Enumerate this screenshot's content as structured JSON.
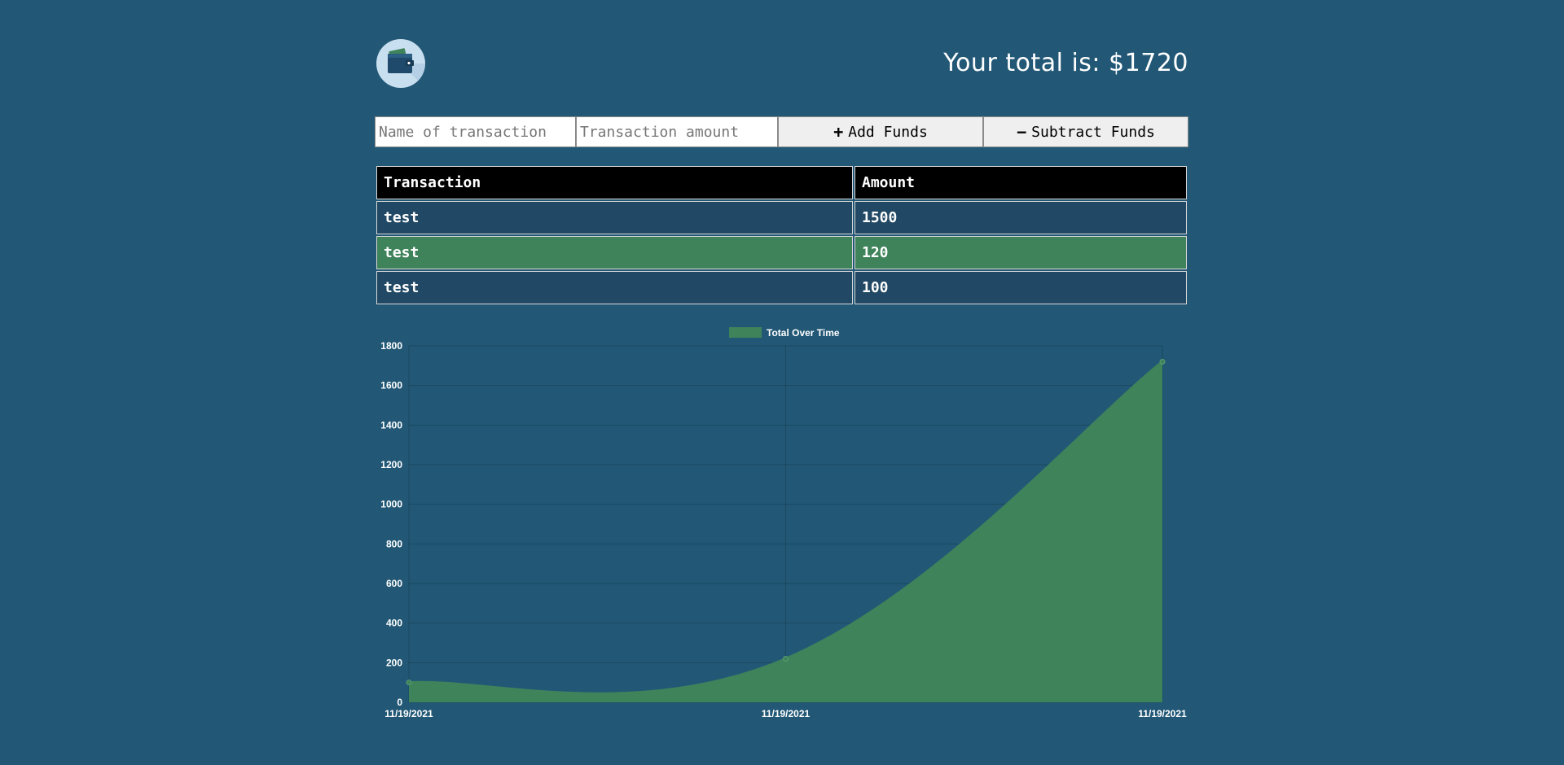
{
  "header": {
    "logo_icon": "wallet-icon",
    "total_text": "Your total is: $1720"
  },
  "form": {
    "name_placeholder": "Name of transaction",
    "amount_placeholder": "Transaction amount",
    "add_label": "Add Funds",
    "add_icon": "plus-icon",
    "subtract_label": "Subtract Funds",
    "subtract_icon": "minus-icon"
  },
  "table": {
    "headers": [
      "Transaction",
      "Amount"
    ],
    "rows": [
      {
        "name": "test",
        "amount": "1500"
      },
      {
        "name": "test",
        "amount": "120"
      },
      {
        "name": "test",
        "amount": "100"
      }
    ]
  },
  "colors": {
    "background": "#225876",
    "series": "#3f835b",
    "row_dark": "#214864",
    "header_row": "#000000"
  },
  "chart_data": {
    "type": "area",
    "legend": [
      "Total Over Time"
    ],
    "legend_position": "top-center",
    "x": [
      "11/19/2021",
      "11/19/2021",
      "11/19/2021"
    ],
    "series": [
      {
        "name": "Total Over Time",
        "values": [
          100,
          220,
          1720
        ]
      }
    ],
    "ylim": [
      0,
      1800
    ],
    "yticks": [
      0,
      200,
      400,
      600,
      800,
      1000,
      1200,
      1400,
      1600,
      1800
    ],
    "grid": true
  }
}
